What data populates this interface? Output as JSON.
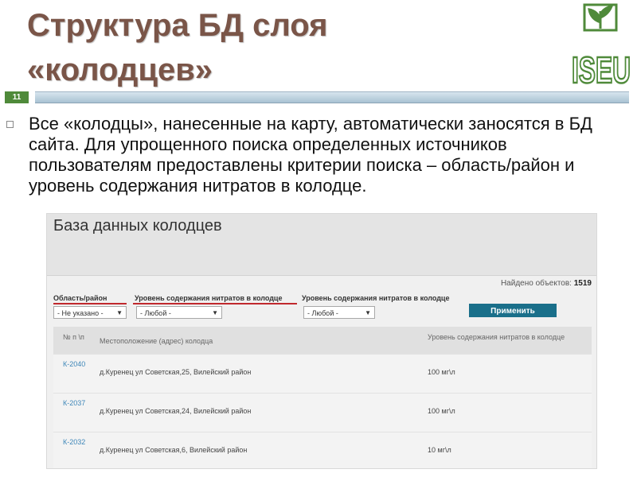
{
  "slide": {
    "title_line1": "Структура БД слоя",
    "title_line2": "«колодцев»",
    "number": "11",
    "bullet": "Все «колодцы», нанесенные на карту, автоматически заносятся в БД сайта. Для упрощенного поиска определенных источников пользователям предоставлены критерии поиска – область/район и уровень содержания нитратов в колодце.",
    "logo_text": "ISEU"
  },
  "site": {
    "title": "База данных колодцев",
    "found_label": "Найдено объектов:",
    "found_count": "1519",
    "filters": {
      "region_label": "Область/район",
      "region_value": "- Не указано -",
      "nitrate_label_1": "Уровень содержания нитратов в колодце",
      "nitrate_value_1": "- Любой -",
      "nitrate_label_2": "Уровень содержания нитратов в колодце",
      "nitrate_value_2": "- Любой -",
      "apply_label": "Применить"
    },
    "table": {
      "headers": [
        "№ п \\п",
        "Местоположение (адрес) колодца",
        "Уровень содержания нитратов в колодце"
      ],
      "rows": [
        {
          "num": "К-2040",
          "address": "д.Куренец ул Советская,25, Вилейский район",
          "level": "100 мг\\л"
        },
        {
          "num": "К-2037",
          "address": "д.Куренец ул Советская,24, Вилейский район",
          "level": "100 мг\\л"
        },
        {
          "num": "К-2032",
          "address": "д.Куренец ул Советская,6, Вилейский район",
          "level": "10 мг\\л"
        }
      ]
    }
  },
  "colors": {
    "title": "#7a5548",
    "accent_green": "#4f8a3a",
    "apply_button": "#1a6f8a",
    "underline_red": "#c0282d",
    "link_blue": "#3d86b8"
  },
  "icons": {
    "logo": "iseu-leaf-logo",
    "bullet": "square-bullet-icon",
    "dropdown": "chevron-down-icon"
  }
}
